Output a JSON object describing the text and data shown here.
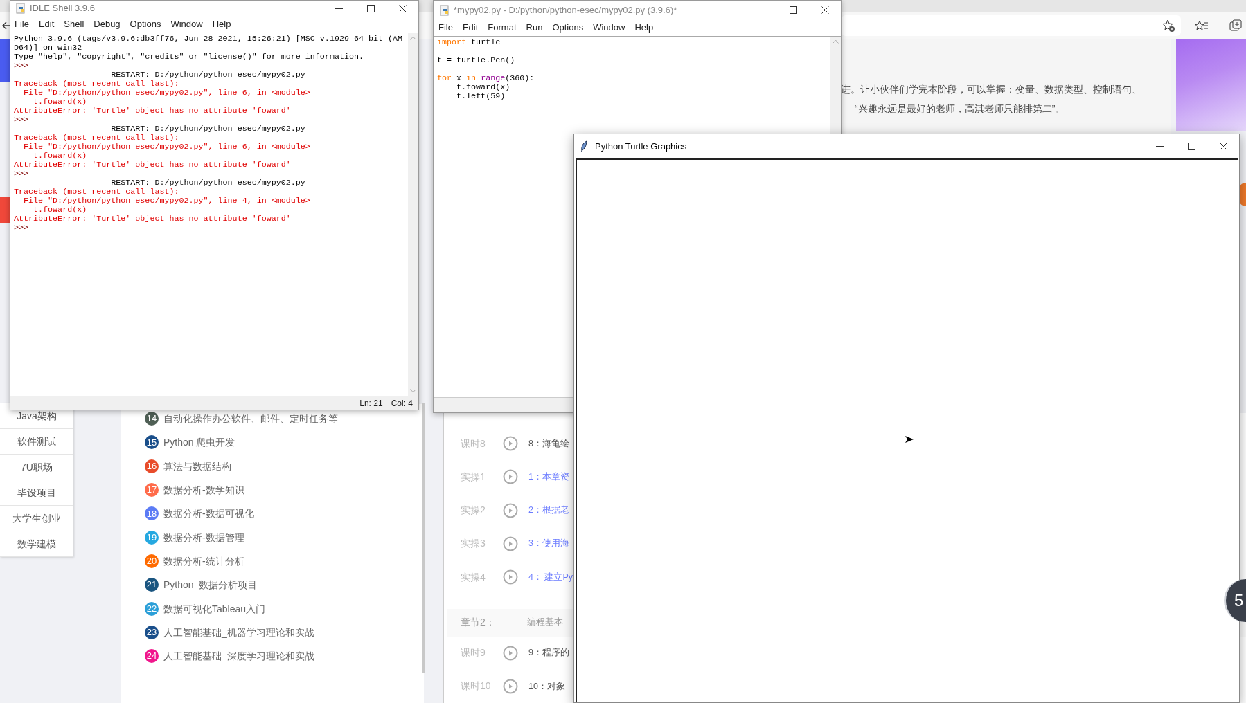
{
  "browser": {
    "intro_lines": [
      "进。让小伙伴们学完本阶段，可以掌握：变量、数据类型、控制语句、",
      "“兴趣永远是最好的老师，高淇老师只能排第二”。"
    ],
    "sidebar": {
      "items": [
        "Java架构",
        "软件测试",
        "7U职场",
        "毕设项目",
        "大学生创业",
        "数学建模"
      ]
    },
    "courses": [
      {
        "number": "14",
        "title": "自动化操作办公软件、邮件、定时任务等",
        "color": "#4f5f55"
      },
      {
        "number": "15",
        "title": "Python 爬虫开发",
        "color": "#1a4f8b"
      },
      {
        "number": "16",
        "title": "算法与数据结构",
        "color": "#e84c2b"
      },
      {
        "number": "17",
        "title": "数据分析-数学知识",
        "color": "#ff6b4a"
      },
      {
        "number": "18",
        "title": "数据分析-数据可视化",
        "color": "#5b7bf5"
      },
      {
        "number": "19",
        "title": "数据分析-数据管理",
        "color": "#25a8e0"
      },
      {
        "number": "20",
        "title": "数据分析-统计分析",
        "color": "#ff6a00"
      },
      {
        "number": "21",
        "title": "Python_数据分析项目",
        "color": "#1a5580"
      },
      {
        "number": "22",
        "title": "数据可视化Tableau入门",
        "color": "#2b9fd8"
      },
      {
        "number": "23",
        "title": "人工智能基础_机器学习理论和实战",
        "color": "#1a4f8b"
      },
      {
        "number": "24",
        "title": "人工智能基础_深度学习理论和实战",
        "color": "#f0168c"
      }
    ],
    "lessons": [
      {
        "kind": "lesson",
        "label": "课时8",
        "title": "8：海龟绘"
      },
      {
        "kind": "practice",
        "label": "实操1",
        "title": "1：本章资"
      },
      {
        "kind": "practice",
        "label": "实操2",
        "title": "2：根据老"
      },
      {
        "kind": "practice",
        "label": "实操3",
        "title": "3：使用海"
      },
      {
        "kind": "practice",
        "label": "实操4",
        "title": "4： 建立Py"
      },
      {
        "kind": "chapter",
        "label": "章节2：",
        "title": "编程基本"
      },
      {
        "kind": "lesson",
        "label": "课时9",
        "title": "9：程序的"
      },
      {
        "kind": "lesson",
        "label": "课时10",
        "title": "10：对象"
      }
    ],
    "badge": "5"
  },
  "shell_window": {
    "title": "IDLE Shell 3.9.6",
    "menu": [
      "File",
      "Edit",
      "Shell",
      "Debug",
      "Options",
      "Window",
      "Help"
    ],
    "lines": [
      {
        "kind": "output",
        "text": "Python 3.9.6 (tags/v3.9.6:db3ff76, Jun 28 2021, 15:26:21) [MSC v.1929 64 bit (AM"
      },
      {
        "kind": "output",
        "text": "D64)] on win32"
      },
      {
        "kind": "output",
        "text": "Type \"help\", \"copyright\", \"credits\" or \"license()\" for more information."
      },
      {
        "kind": "prompt",
        "text": ">>>"
      },
      {
        "kind": "output",
        "text": "=================== RESTART: D:/python/python-esec/mypy02.py ==================="
      },
      {
        "kind": "error",
        "text": "Traceback (most recent call last):"
      },
      {
        "kind": "error",
        "text": "  File \"D:/python/python-esec/mypy02.py\", line 6, in <module>"
      },
      {
        "kind": "error",
        "text": "    t.foward(x)"
      },
      {
        "kind": "error",
        "text": "AttributeError: 'Turtle' object has no attribute 'foward'"
      },
      {
        "kind": "prompt",
        "text": ">>>"
      },
      {
        "kind": "output",
        "text": "=================== RESTART: D:/python/python-esec/mypy02.py ==================="
      },
      {
        "kind": "error",
        "text": "Traceback (most recent call last):"
      },
      {
        "kind": "error",
        "text": "  File \"D:/python/python-esec/mypy02.py\", line 6, in <module>"
      },
      {
        "kind": "error",
        "text": "    t.foward(x)"
      },
      {
        "kind": "error",
        "text": "AttributeError: 'Turtle' object has no attribute 'foward'"
      },
      {
        "kind": "prompt",
        "text": ">>>"
      },
      {
        "kind": "output",
        "text": "=================== RESTART: D:/python/python-esec/mypy02.py ==================="
      },
      {
        "kind": "error",
        "text": "Traceback (most recent call last):"
      },
      {
        "kind": "error",
        "text": "  File \"D:/python/python-esec/mypy02.py\", line 4, in <module>"
      },
      {
        "kind": "error",
        "text": "    t.foward(x)"
      },
      {
        "kind": "error",
        "text": "AttributeError: 'Turtle' object has no attribute 'foward'"
      },
      {
        "kind": "prompt",
        "text": ">>>"
      }
    ],
    "status": {
      "line": "Ln: 21",
      "col": "Col: 4"
    }
  },
  "editor_window": {
    "title": "*mypy02.py - D:/python/python-esec/mypy02.py (3.9.6)*",
    "menu": [
      "File",
      "Edit",
      "Format",
      "Run",
      "Options",
      "Window",
      "Help"
    ],
    "code": [
      {
        "tokens": [
          {
            "kind": "keyword",
            "text": "import"
          },
          {
            "kind": "plain",
            "text": " turtle"
          }
        ]
      },
      {
        "kind": "blank"
      },
      {
        "tokens": [
          {
            "kind": "plain",
            "text": "t = turtle.Pen()"
          }
        ]
      },
      {
        "kind": "blank"
      },
      {
        "tokens": [
          {
            "kind": "keyword",
            "text": "for"
          },
          {
            "kind": "plain",
            "text": " x "
          },
          {
            "kind": "keyword",
            "text": "in "
          },
          {
            "kind": "builtin",
            "text": "range"
          },
          {
            "kind": "plain",
            "text": "(360):"
          }
        ]
      },
      {
        "tokens": [
          {
            "kind": "plain",
            "text": "    t.foward(x)"
          }
        ]
      },
      {
        "tokens": [
          {
            "kind": "plain",
            "text": "    t.left(59)"
          }
        ]
      }
    ]
  },
  "turtle_window": {
    "title": "Python Turtle Graphics"
  }
}
